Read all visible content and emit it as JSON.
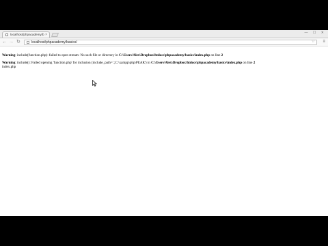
{
  "browser": {
    "tab": {
      "title": "localhost/phpacademy/b",
      "close_glyph": "×"
    },
    "window_controls": "— ☐ ✕",
    "toolbar": {
      "back_glyph": "←",
      "forward_glyph": "→",
      "reload_glyph": "↻",
      "address": "localhost/phpacademy/basics/",
      "star_glyph": "☆",
      "menu_glyph": "≡"
    }
  },
  "page": {
    "warning1": {
      "label": "Warning",
      "text1": ": include(function.php): failed to open stream: No such file or directory in ",
      "path": "C:\\Users\\Alex\\Dropbox\\htdocs\\phpacademy\\basics\\index.php",
      "text2": " on line ",
      "line": "2"
    },
    "warning2": {
      "label": "Warning",
      "text1": ": include(): Failed opening 'function.php' for inclusion (include_path='.;C:\\xampp\\php\\PEAR') in ",
      "path": "C:\\Users\\Alex\\Dropbox\\htdocs\\phpacademy\\basics\\index.php",
      "text2": " on line ",
      "line": "2"
    },
    "output": "index.php"
  }
}
